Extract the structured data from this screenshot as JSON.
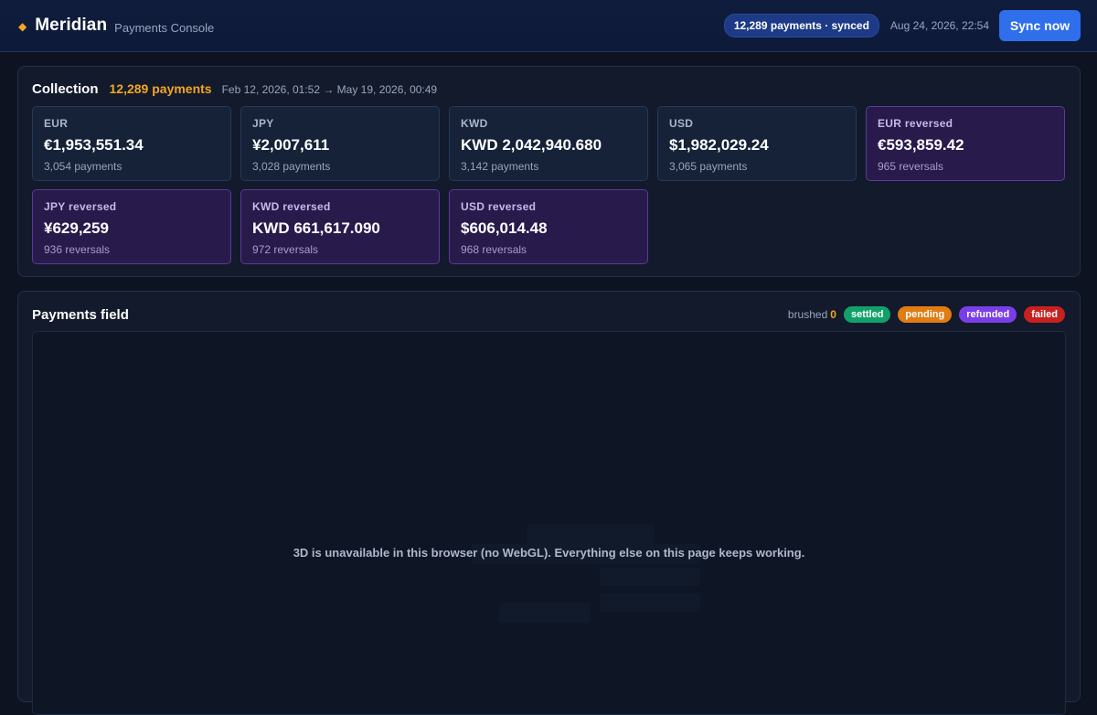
{
  "header": {
    "brand": "Meridian",
    "subtitle": "Payments Console",
    "sync_status": "12,289 payments · synced",
    "timestamp": "Aug 24, 2026, 22:54",
    "sync_button": "Sync now"
  },
  "collection": {
    "title": "Collection",
    "count": "12,289 payments",
    "range": "Feb 12, 2026, 01:52 → May 19, 2026, 00:49",
    "cards": [
      {
        "label": "EUR",
        "amount": "€1,953,551.34",
        "sub": "3,054 payments"
      },
      {
        "label": "JPY",
        "amount": "¥2,007,611",
        "sub": "3,028 payments"
      },
      {
        "label": "KWD",
        "amount": "KWD 2,042,940.680",
        "sub": "3,142 payments"
      },
      {
        "label": "USD",
        "amount": "$1,982,029.24",
        "sub": "3,065 payments"
      },
      {
        "label": "EUR reversed",
        "amount": "€593,859.42",
        "sub": "965 reversals"
      },
      {
        "label": "JPY reversed",
        "amount": "¥629,259",
        "sub": "936 reversals"
      },
      {
        "label": "KWD reversed",
        "amount": "KWD 661,617.090",
        "sub": "972 reversals"
      },
      {
        "label": "USD reversed",
        "amount": "$606,014.48",
        "sub": "968 reversals"
      }
    ]
  },
  "field": {
    "title": "Payments field",
    "brushed_label": "brushed",
    "brushed_count": "0",
    "legend": [
      {
        "label": "settled",
        "color": "#12a06a"
      },
      {
        "label": "pending",
        "color": "#e07c12"
      },
      {
        "label": "refunded",
        "color": "#7a3ee8"
      },
      {
        "label": "failed",
        "color": "#c8201f"
      }
    ],
    "message": "3D is unavailable in this browser (no WebGL). Everything else on this page keeps working."
  },
  "colors": {
    "accent": "#f5a524",
    "primary_button": "#2f6fec",
    "reversed_card": "#291a4c"
  },
  "icons": {
    "brand": "diamond-icon"
  }
}
